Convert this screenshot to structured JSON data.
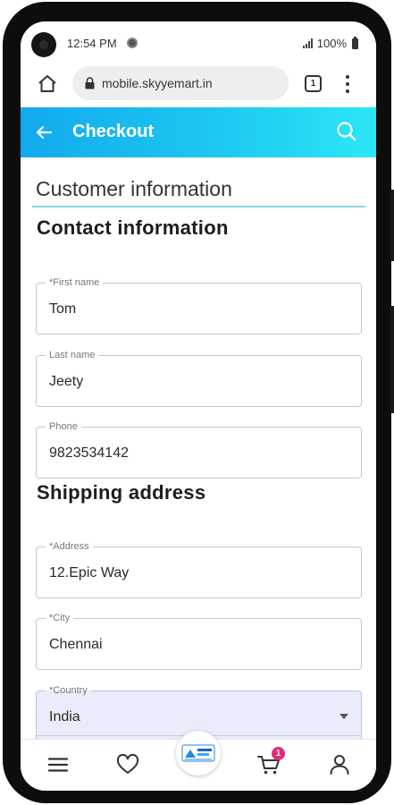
{
  "status_bar": {
    "time": "12:54 PM",
    "battery": "100%",
    "icons": [
      "signal-icon",
      "battery-icon",
      "notification-dot-icon"
    ]
  },
  "browser": {
    "url": "mobile.skyyemart.in",
    "tab_count": "1",
    "icons": [
      "home-icon",
      "lock-icon",
      "tabs-icon",
      "more-vert-icon"
    ]
  },
  "app_bar": {
    "title": "Checkout",
    "icons": [
      "back-arrow-icon",
      "search-icon"
    ],
    "colors": {
      "gradient_start": "#14a9ee",
      "gradient_end": "#2de6f6"
    }
  },
  "page": {
    "section_title": "Customer information",
    "contact_heading": "Contact information",
    "shipping_heading": "Shipping address"
  },
  "fields": {
    "first_name": {
      "label": "*First name",
      "value": "Tom"
    },
    "last_name": {
      "label": "Last name",
      "value": "Jeety"
    },
    "phone": {
      "label": "Phone",
      "value": "9823534142"
    },
    "address": {
      "label": "*Address",
      "value": "12.Epic Way"
    },
    "city": {
      "label": "*City",
      "value": "Chennai"
    },
    "country": {
      "label": "*Country",
      "value": "India"
    }
  },
  "bottom_nav": {
    "cart_count": "1",
    "icons": [
      "menu-icon",
      "heart-icon",
      "skyyemart-logo",
      "cart-icon",
      "user-icon"
    ],
    "badge_color": "#e6287a"
  }
}
